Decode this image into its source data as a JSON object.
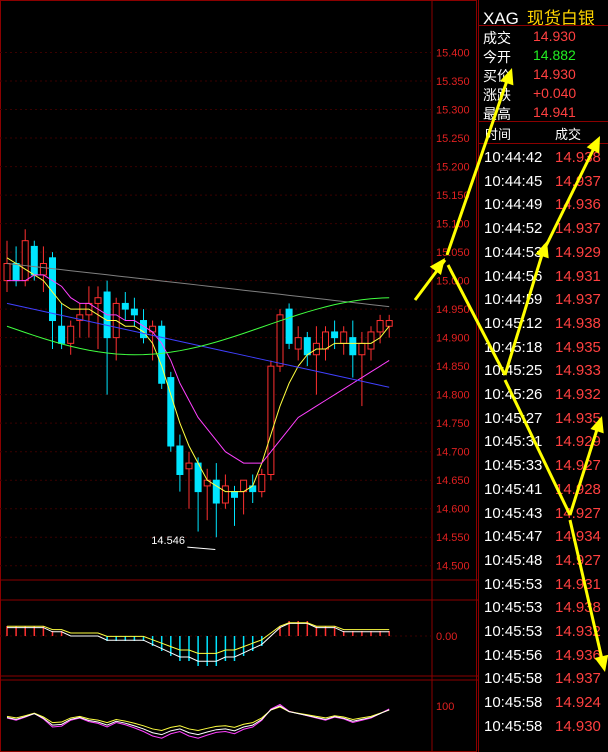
{
  "header": {
    "symbol": "XAG",
    "name": "现货白银"
  },
  "quote": [
    {
      "label": "成交",
      "value": "14.930",
      "color": "#ff4040"
    },
    {
      "label": "今开",
      "value": "14.882",
      "color": "#22ee22"
    },
    {
      "label": "买价",
      "value": "14.930",
      "color": "#ff4040"
    },
    {
      "label": "涨跌",
      "value": "+0.040",
      "color": "#ff4040"
    },
    {
      "label": "最高",
      "value": "14.941",
      "color": "#ff4040"
    }
  ],
  "ticks_header": {
    "time": "时间",
    "price": "成交"
  },
  "ticks": [
    {
      "time": "10:44:42",
      "price": "14.938"
    },
    {
      "time": "10:44:45",
      "price": "14.937"
    },
    {
      "time": "10:44:49",
      "price": "14.936"
    },
    {
      "time": "10:44:52",
      "price": "14.937"
    },
    {
      "time": "10:44:53",
      "price": "14.929"
    },
    {
      "time": "10:44:56",
      "price": "14.931"
    },
    {
      "time": "10:44:59",
      "price": "14.937"
    },
    {
      "time": "10:45:12",
      "price": "14.938"
    },
    {
      "time": "10:45:18",
      "price": "14.935"
    },
    {
      "time": "10:45:25",
      "price": "14.933"
    },
    {
      "time": "10:45:26",
      "price": "14.932"
    },
    {
      "time": "10:45:27",
      "price": "14.935"
    },
    {
      "time": "10:45:31",
      "price": "14.929"
    },
    {
      "time": "10:45:33",
      "price": "14.927"
    },
    {
      "time": "10:45:41",
      "price": "14.928"
    },
    {
      "time": "10:45:43",
      "price": "14.927"
    },
    {
      "time": "10:45:47",
      "price": "14.934"
    },
    {
      "time": "10:45:48",
      "price": "14.927"
    },
    {
      "time": "10:45:53",
      "price": "14.931"
    },
    {
      "time": "10:45:53",
      "price": "14.938"
    },
    {
      "time": "10:45:53",
      "price": "14.932"
    },
    {
      "time": "10:45:56",
      "price": "14.936"
    },
    {
      "time": "10:45:58",
      "price": "14.937"
    },
    {
      "time": "10:45:58",
      "price": "14.924"
    },
    {
      "time": "10:45:58",
      "price": "14.930"
    }
  ],
  "chart": {
    "price_axis": [
      "15.400",
      "15.350",
      "15.300",
      "15.250",
      "15.200",
      "15.150",
      "15.100",
      "15.050",
      "15.000",
      "14.950",
      "14.900",
      "14.850",
      "14.800",
      "14.750",
      "14.700",
      "14.650",
      "14.600",
      "14.550",
      "14.500"
    ],
    "low_label": "14.546",
    "macd_axis": "0.00",
    "kdj_axis": "100",
    "colors": {
      "up": "#ff3030",
      "down": "#00e5ff",
      "ma1": "#ffffff",
      "ma2": "#ffff40",
      "ma3": "#ff40ff",
      "ma4": "#40ff40",
      "ma5": "#808080",
      "ma6": "#4040ff",
      "annot": "#ffff00"
    },
    "candles": [
      [
        15.0,
        15.07,
        14.98,
        15.03
      ],
      [
        15.03,
        15.06,
        14.99,
        15.0
      ],
      [
        15.0,
        15.09,
        14.99,
        15.07
      ],
      [
        15.06,
        15.07,
        15.0,
        15.01
      ],
      [
        15.01,
        15.06,
        14.98,
        15.03
      ],
      [
        15.04,
        15.05,
        14.88,
        14.93
      ],
      [
        14.92,
        14.96,
        14.88,
        14.89
      ],
      [
        14.89,
        14.93,
        14.87,
        14.92
      ],
      [
        14.93,
        14.96,
        14.9,
        14.94
      ],
      [
        14.94,
        14.99,
        14.9,
        14.96
      ],
      [
        14.96,
        14.99,
        14.88,
        14.97
      ],
      [
        14.98,
        15.0,
        14.8,
        14.9
      ],
      [
        14.9,
        14.97,
        14.86,
        14.96
      ],
      [
        14.96,
        14.98,
        14.93,
        14.95
      ],
      [
        14.95,
        14.97,
        14.92,
        14.94
      ],
      [
        14.93,
        14.95,
        14.89,
        14.9
      ],
      [
        14.91,
        14.93,
        14.86,
        14.92
      ],
      [
        14.92,
        14.93,
        14.81,
        14.82
      ],
      [
        14.83,
        14.84,
        14.7,
        14.71
      ],
      [
        14.71,
        14.73,
        14.63,
        14.66
      ],
      [
        14.67,
        14.7,
        14.6,
        14.68
      ],
      [
        14.68,
        14.69,
        14.56,
        14.63
      ],
      [
        14.64,
        14.67,
        14.58,
        14.65
      ],
      [
        14.65,
        14.68,
        14.55,
        14.61
      ],
      [
        14.61,
        14.66,
        14.6,
        14.64
      ],
      [
        14.63,
        14.64,
        14.57,
        14.62
      ],
      [
        14.63,
        14.65,
        14.59,
        14.65
      ],
      [
        14.64,
        14.66,
        14.61,
        14.63
      ],
      [
        14.63,
        14.67,
        14.62,
        14.66
      ],
      [
        14.66,
        14.86,
        14.65,
        14.85
      ],
      [
        14.85,
        14.95,
        14.84,
        14.94
      ],
      [
        14.95,
        14.96,
        14.88,
        14.89
      ],
      [
        14.88,
        14.92,
        14.86,
        14.9
      ],
      [
        14.9,
        14.91,
        14.85,
        14.87
      ],
      [
        14.87,
        14.92,
        14.8,
        14.89
      ],
      [
        14.88,
        14.92,
        14.86,
        14.91
      ],
      [
        14.91,
        14.93,
        14.88,
        14.9
      ],
      [
        14.89,
        14.92,
        14.87,
        14.91
      ],
      [
        14.9,
        14.93,
        14.83,
        14.87
      ],
      [
        14.87,
        14.91,
        14.78,
        14.89
      ],
      [
        14.88,
        14.92,
        14.86,
        14.91
      ],
      [
        14.91,
        14.94,
        14.89,
        14.93
      ],
      [
        14.92,
        14.94,
        14.9,
        14.93
      ]
    ],
    "ma_fast": [
      15.04,
      15.03,
      15.02,
      15.01,
      15.0,
      14.98,
      14.96,
      14.95,
      14.95,
      14.95,
      14.94,
      14.93,
      14.93,
      14.92,
      14.92,
      14.91,
      14.89,
      14.85,
      14.8,
      14.75,
      14.71,
      14.68,
      14.65,
      14.64,
      14.63,
      14.63,
      14.63,
      14.64,
      14.68,
      14.73,
      14.78,
      14.82,
      14.85,
      14.87,
      14.88,
      14.88,
      14.89,
      14.89,
      14.89,
      14.89,
      14.89,
      14.9,
      14.92
    ],
    "ma_mid": [
      15.0,
      15.0,
      15.0,
      15.01,
      15.01,
      15.0,
      14.99,
      14.97,
      14.96,
      14.96,
      14.95,
      14.94,
      14.94,
      14.93,
      14.93,
      14.92,
      14.91,
      14.89,
      14.86,
      14.82,
      14.79,
      14.76,
      14.74,
      14.72,
      14.7,
      14.69,
      14.68,
      14.68,
      14.68,
      14.7,
      14.72,
      14.74,
      14.76,
      14.77,
      14.78,
      14.79,
      14.8,
      14.81,
      14.82,
      14.83,
      14.84,
      14.85,
      14.86
    ]
  },
  "macd": [
    0.02,
    0.02,
    0.02,
    0.02,
    0.02,
    0.01,
    0.01,
    0.0,
    0.0,
    0.0,
    0.0,
    -0.01,
    -0.01,
    -0.01,
    -0.01,
    -0.01,
    -0.02,
    -0.03,
    -0.04,
    -0.05,
    -0.05,
    -0.06,
    -0.06,
    -0.06,
    -0.05,
    -0.05,
    -0.04,
    -0.03,
    -0.02,
    0.0,
    0.02,
    0.03,
    0.03,
    0.03,
    0.02,
    0.02,
    0.02,
    0.01,
    0.01,
    0.01,
    0.01,
    0.01,
    0.01
  ]
}
